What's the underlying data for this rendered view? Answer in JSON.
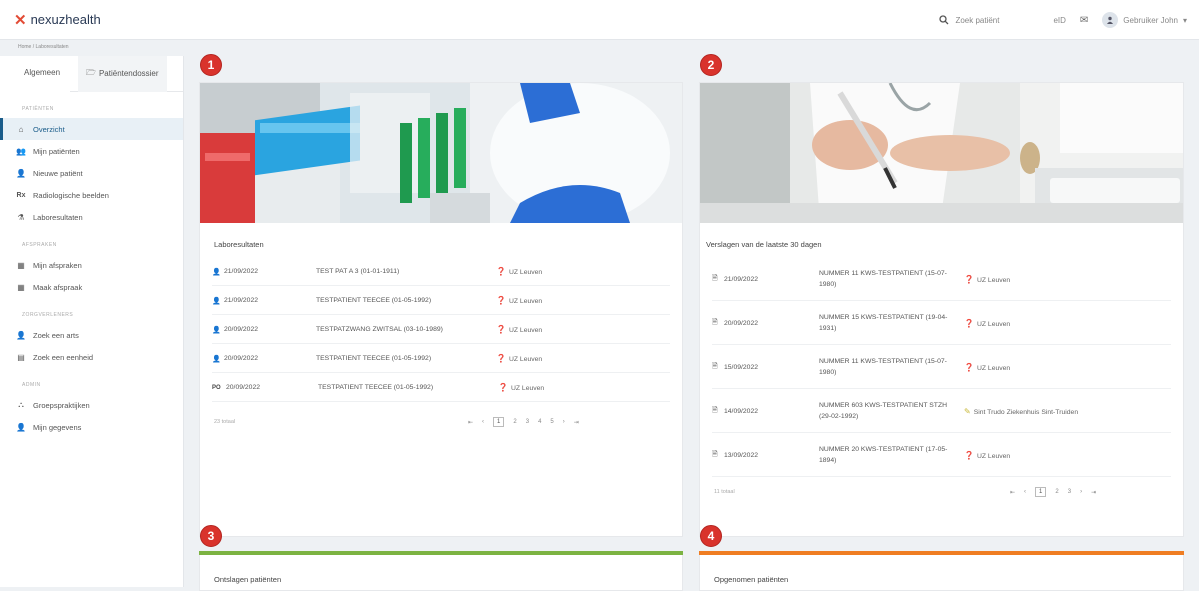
{
  "header": {
    "logo_text": "nexuzhealth",
    "search_placeholder": "Zoek patiënt",
    "eid_label": "eID",
    "user_label": "Gebruiker John"
  },
  "breadcrumb": "Home / Laboresultaten",
  "sidebar": {
    "tabs": [
      {
        "label": "Algemeen"
      },
      {
        "label": "Patiëntendossier"
      }
    ],
    "sections": [
      {
        "title": "PATIËNTEN",
        "items": [
          {
            "icon": "home-icon",
            "label": "Overzicht"
          },
          {
            "icon": "users-icon",
            "label": "Mijn patiënten"
          },
          {
            "icon": "add-user-icon",
            "label": "Nieuwe patiënt"
          },
          {
            "icon": "rx-icon",
            "label": "Radiologische beelden"
          },
          {
            "icon": "flask-icon",
            "label": "Laboresultaten"
          }
        ]
      },
      {
        "title": "AFSPRAKEN",
        "items": [
          {
            "icon": "calendar-icon",
            "label": "Mijn afspraken"
          },
          {
            "icon": "calendar-add-icon",
            "label": "Maak afspraak"
          }
        ]
      },
      {
        "title": "ZORGVERLENERS",
        "items": [
          {
            "icon": "doctor-icon",
            "label": "Zoek een arts"
          },
          {
            "icon": "building-icon",
            "label": "Zoek een eenheid"
          }
        ]
      },
      {
        "title": "ADMIN",
        "items": [
          {
            "icon": "group-icon",
            "label": "Groepspraktijken"
          },
          {
            "icon": "person-icon",
            "label": "Mijn gegevens"
          }
        ]
      }
    ]
  },
  "cards": {
    "lab": {
      "badge": "1",
      "title": "Laboresultaten",
      "rows": [
        {
          "icon": "person-icon",
          "date": "21/09/2022",
          "name": "TEST PAT A 3 (01-01-1911)",
          "loc": "UZ Leuven"
        },
        {
          "icon": "person-icon",
          "date": "21/09/2022",
          "name": "TESTPATIENT TEECEE (01-05-1992)",
          "loc": "UZ Leuven"
        },
        {
          "icon": "person-icon",
          "date": "20/09/2022",
          "name": "TESTPATZWANG ZWITSAL (03-10-1989)",
          "loc": "UZ Leuven"
        },
        {
          "icon": "person-icon",
          "date": "20/09/2022",
          "name": "TESTPATIENT TEECEE (01-05-1992)",
          "loc": "UZ Leuven"
        },
        {
          "icon": "po-icon",
          "icon_text": "PO",
          "date": "20/09/2022",
          "name": "TESTPATIENT TEECEE (01-05-1992)",
          "loc": "UZ Leuven"
        }
      ],
      "count": "23 totaal",
      "pages": [
        "1",
        "2",
        "3",
        "4",
        "5"
      ]
    },
    "reports": {
      "badge": "2",
      "title": "Verslagen van de laatste 30 dagen",
      "rows": [
        {
          "date": "21/09/2022",
          "name": "NUMMER 11 KWS-TESTPATIENT (15-07-",
          "name2": "1980)",
          "loc": "UZ Leuven"
        },
        {
          "date": "20/09/2022",
          "name": "NUMMER 15 KWS-TESTPATIENT (19-04-",
          "name2": "1931)",
          "loc": "UZ Leuven"
        },
        {
          "date": "15/09/2022",
          "name": "NUMMER 11 KWS-TESTPATIENT (15-07-",
          "name2": "1980)",
          "loc": "UZ Leuven"
        },
        {
          "date": "14/09/2022",
          "name": "NUMMER 603 KWS-TESTPATIENT STZH",
          "name2": "(29-02-1992)",
          "loc": "Sint Trudo Ziekenhuis Sint-Truiden"
        },
        {
          "date": "13/09/2022",
          "name": "NUMMER 20 KWS-TESTPATIENT (17-05-",
          "name2": "1894)",
          "loc": "UZ Leuven"
        }
      ],
      "count": "11 totaal",
      "pages": [
        "1",
        "2",
        "3"
      ]
    },
    "discharged": {
      "badge": "3",
      "title": "Ontslagen patiënten",
      "color": "#7cb342"
    },
    "admitted": {
      "badge": "4",
      "title": "Opgenomen patiënten",
      "color": "#ef7d22"
    }
  }
}
